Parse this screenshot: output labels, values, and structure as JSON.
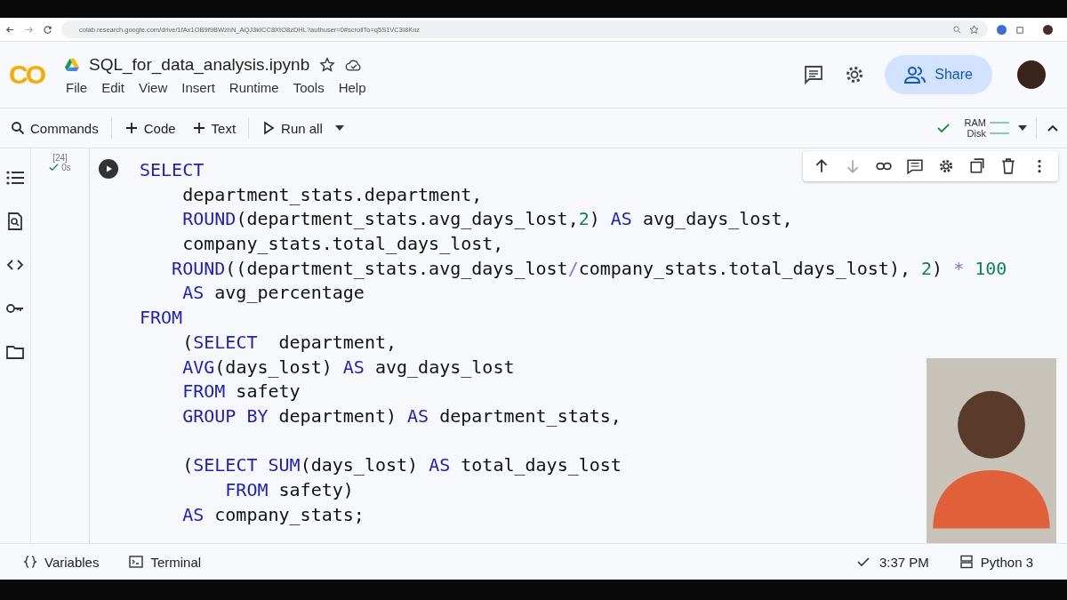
{
  "browser": {
    "url": "colab.research.google.com/drive/1fAx1OB9f9BWzhN_AQJ3kICC8XtO8zDHL?authuser=0#scrollTo=q5S1VC3I8Knz"
  },
  "header": {
    "logo": "CO",
    "title": "SQL_for_data_analysis.ipynb",
    "menu": [
      "File",
      "Edit",
      "View",
      "Insert",
      "Runtime",
      "Tools",
      "Help"
    ],
    "share": "Share"
  },
  "toolbar": {
    "commands": "Commands",
    "add_code": "Code",
    "add_text": "Text",
    "run_all": "Run all",
    "ram": "RAM",
    "disk": "Disk"
  },
  "cell": {
    "count": "[24]",
    "time": "0s",
    "lines": [
      {
        "kind": "code",
        "tokens": [
          {
            "t": "SELECT",
            "kind": "keyword"
          }
        ]
      },
      {
        "kind": "code",
        "tokens": [
          {
            "t": "    department_stats.department,",
            "kind": "identifier"
          }
        ]
      },
      {
        "kind": "code",
        "tokens": [
          {
            "t": "    ROUND",
            "kind": "keyword"
          },
          {
            "t": "(department_stats.avg_days_lost,",
            "kind": "identifier"
          },
          {
            "t": "2",
            "kind": "number"
          },
          {
            "t": ") ",
            "kind": "identifier"
          },
          {
            "t": "AS",
            "kind": "keyword"
          },
          {
            "t": " avg_days_lost,",
            "kind": "identifier"
          }
        ]
      },
      {
        "kind": "code",
        "tokens": [
          {
            "t": "    company_stats.total_days_lost,",
            "kind": "identifier"
          }
        ]
      },
      {
        "kind": "code",
        "tokens": [
          {
            "t": "   ROUND",
            "kind": "keyword"
          },
          {
            "t": "((department_stats.avg_days_lost",
            "kind": "identifier"
          },
          {
            "t": "/",
            "kind": "operator"
          },
          {
            "t": "company_stats.total_days_lost), ",
            "kind": "identifier"
          },
          {
            "t": "2",
            "kind": "number"
          },
          {
            "t": ") ",
            "kind": "identifier"
          },
          {
            "t": "* ",
            "kind": "operator"
          },
          {
            "t": "100",
            "kind": "number"
          }
        ]
      },
      {
        "kind": "code",
        "tokens": [
          {
            "t": "    AS",
            "kind": "keyword"
          },
          {
            "t": " avg_percentage",
            "kind": "identifier"
          }
        ]
      },
      {
        "kind": "code",
        "tokens": [
          {
            "t": "FROM",
            "kind": "keyword"
          }
        ]
      },
      {
        "kind": "code",
        "tokens": [
          {
            "t": "    (",
            "kind": "identifier"
          },
          {
            "t": "SELECT",
            "kind": "keyword"
          },
          {
            "t": "  department,",
            "kind": "identifier"
          }
        ]
      },
      {
        "kind": "code",
        "tokens": [
          {
            "t": "    AVG",
            "kind": "keyword"
          },
          {
            "t": "(days_lost) ",
            "kind": "identifier"
          },
          {
            "t": "AS",
            "kind": "keyword"
          },
          {
            "t": " avg_days_lost",
            "kind": "identifier"
          }
        ]
      },
      {
        "kind": "code",
        "tokens": [
          {
            "t": "    FROM",
            "kind": "keyword"
          },
          {
            "t": " safety",
            "kind": "identifier"
          }
        ]
      },
      {
        "kind": "code",
        "tokens": [
          {
            "t": "    GROUP BY",
            "kind": "keyword"
          },
          {
            "t": " department) ",
            "kind": "identifier"
          },
          {
            "t": "AS",
            "kind": "keyword"
          },
          {
            "t": " department_stats,",
            "kind": "identifier"
          }
        ]
      },
      {
        "kind": "blank"
      },
      {
        "kind": "code",
        "tokens": [
          {
            "t": "    (",
            "kind": "identifier"
          },
          {
            "t": "SELECT",
            "kind": "keyword"
          },
          {
            "t": " SUM",
            "kind": "keyword"
          },
          {
            "t": "(days_lost) ",
            "kind": "identifier"
          },
          {
            "t": "AS",
            "kind": "keyword"
          },
          {
            "t": " total_days_lost",
            "kind": "identifier"
          }
        ]
      },
      {
        "kind": "code",
        "tokens": [
          {
            "t": "        FROM",
            "kind": "keyword"
          },
          {
            "t": " safety)",
            "kind": "identifier"
          }
        ]
      },
      {
        "kind": "code",
        "tokens": [
          {
            "t": "    AS",
            "kind": "keyword"
          },
          {
            "t": " company_stats;",
            "kind": "identifier"
          }
        ]
      }
    ]
  },
  "status_bar": {
    "variables": "Variables",
    "terminal": "Terminal",
    "time": "3:37 PM",
    "runtime": "Python 3"
  }
}
